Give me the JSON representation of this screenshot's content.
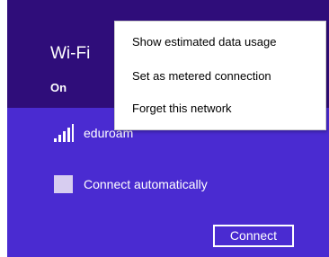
{
  "colors": {
    "panel_background": "#4a2bd1",
    "header_background": "#2f0d7a",
    "text": "#ffffff",
    "checkbox_fill": "#d7cdf0",
    "menu_background": "#ffffff"
  },
  "header": {
    "title": "Wi-Fi",
    "state": "On"
  },
  "network": {
    "icon": "wifi-signal-icon",
    "name": "eduroam"
  },
  "options": {
    "connect_automatically_label": "Connect automatically",
    "connect_automatically_checked": false
  },
  "actions": {
    "connect_label": "Connect"
  },
  "context_menu": {
    "items": [
      {
        "label": "Show estimated data usage"
      },
      {
        "label": "Set as metered connection"
      },
      {
        "label": "Forget this network"
      }
    ]
  }
}
